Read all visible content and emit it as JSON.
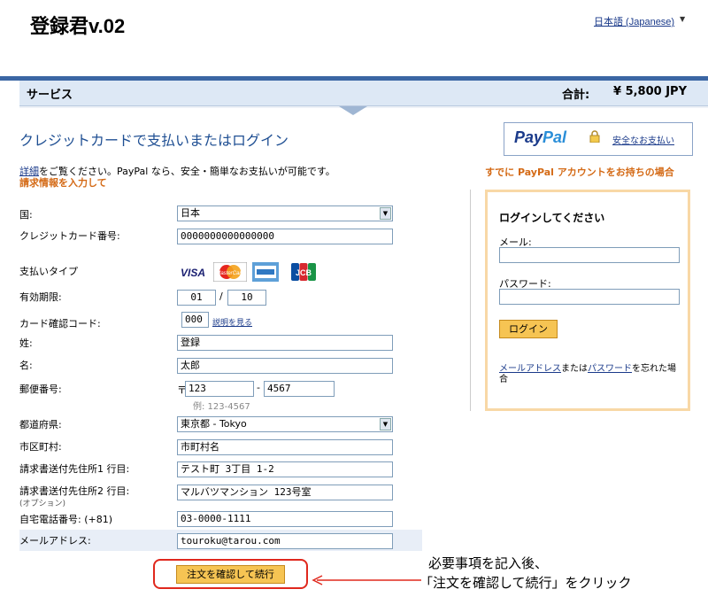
{
  "app_title": "登録君v.02",
  "language": "日本語 (Japanese)",
  "service_bar": {
    "label": "サービス",
    "total_label": "合計:",
    "total_value": "¥ 5,800 JPY"
  },
  "heading": "クレジットカードで支払いまたはログイン",
  "paypal": {
    "logo_part1": "Pay",
    "logo_part2": "Pal",
    "secure_label": "安全なお支払い"
  },
  "intro": {
    "link": "詳細",
    "text": "をご覧ください。PayPal なら、安全・簡単なお支払いが可能です。"
  },
  "billing_title": "請求情報を入力して",
  "already_account": "すでに PayPal アカウントをお持ちの場合",
  "form": {
    "country_label": "国:",
    "country_value": "日本",
    "card_number_label": "クレジットカード番号:",
    "card_number_value": "0000000000000000",
    "payment_type_label": "支払いタイプ",
    "cards": [
      "VISA",
      "MasterCard",
      "AMEX",
      "JCB"
    ],
    "expiry_label": "有効期限:",
    "expiry_month": "01",
    "expiry_sep": "/",
    "expiry_year": "10",
    "cvv_label": "カード確認コード:",
    "cvv_value": "000",
    "cvv_help": "説明を見る",
    "last_name_label": "姓:",
    "last_name_value": "登録",
    "first_name_label": "名:",
    "first_name_value": "太郎",
    "postal_label": "郵便番号:",
    "postal_prefix": "〒",
    "postal_1": "123",
    "postal_sep": "-",
    "postal_2": "4567",
    "postal_example": "例: 123-4567",
    "prefecture_label": "都道府県:",
    "prefecture_value": "東京都 - Tokyo",
    "city_label": "市区町村:",
    "city_value": "市町村名",
    "address1_label": "請求書送付先住所1 行目:",
    "address1_value": "テスト町 3丁目 1-2",
    "address2_label": "請求書送付先住所2 行目:",
    "address2_note": "(オプション)",
    "address2_value": "マルバツマンション 123号室",
    "phone_label": "自宅電話番号: (+81)",
    "phone_value": "03-0000-1111",
    "email_label": "メールアドレス:",
    "email_value": "touroku@tarou.com"
  },
  "submit_label": "注文を確認して続行",
  "annotation": {
    "line1": "必要事項を記入後、",
    "line2": "「注文を確認して続行」をクリック"
  },
  "login": {
    "title": "ログインしてください",
    "email_label": "メール:",
    "password_label": "パスワード:",
    "button": "ログイン",
    "forgot_link1": "メールアドレス",
    "forgot_mid": "または",
    "forgot_link2": "パスワード",
    "forgot_end": "を忘れた場合"
  }
}
